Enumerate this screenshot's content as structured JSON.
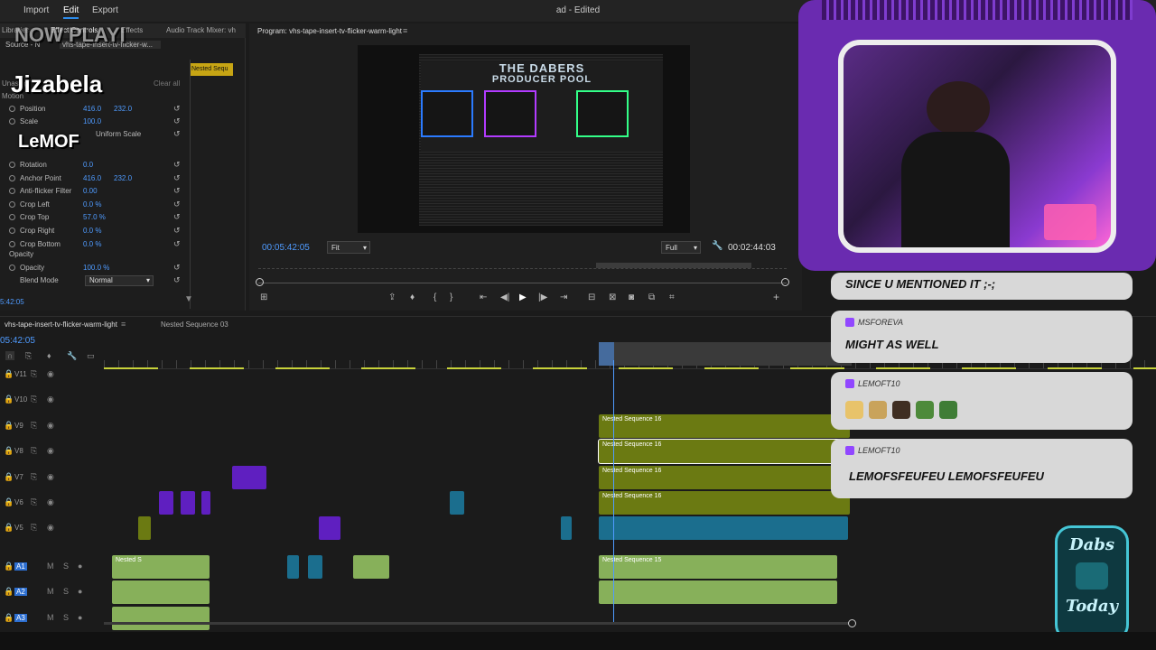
{
  "menu": {
    "items": [
      "Import",
      "Edit",
      "Export"
    ],
    "active": "Edit",
    "title": "ad - Edited"
  },
  "effects": {
    "tabs": [
      "Libraries",
      "Effect Controls",
      "Effects",
      "Audio Track Mixer: vh"
    ],
    "source_tab": "Source - N",
    "clip_tab": "vhs-tape-insert-tv-flicker-w...",
    "nested_label": "Nested Sequ",
    "clear_all": "Clear all",
    "section": "Unassig",
    "motion_label": "Motion",
    "rows": [
      {
        "label": "Position",
        "v1": "416.0",
        "v2": "232.0"
      },
      {
        "label": "Scale",
        "v1": "100.0",
        "v2": ""
      },
      {
        "label": "Uniform Scale",
        "v1": "",
        "v2": ""
      },
      {
        "label": "Rotation",
        "v1": "0.0",
        "v2": ""
      },
      {
        "label": "Anchor Point",
        "v1": "416.0",
        "v2": "232.0"
      },
      {
        "label": "Anti-flicker Filter",
        "v1": "0.00",
        "v2": ""
      },
      {
        "label": "Crop Left",
        "v1": "0.0 %",
        "v2": ""
      },
      {
        "label": "Crop Top",
        "v1": "57.0 %",
        "v2": ""
      },
      {
        "label": "Crop Right",
        "v1": "0.0 %",
        "v2": ""
      },
      {
        "label": "Crop Bottom",
        "v1": "0.0 %",
        "v2": ""
      }
    ],
    "opacity_section": "Opacity",
    "opacity_label": "Opacity",
    "opacity_value": "100.0 %",
    "blend_label": "Blend Mode",
    "blend_value": "Normal",
    "timecode": "5:42:05"
  },
  "overlays": {
    "now_playing": "NOW PLAYI",
    "name1": "Jizabela",
    "name2": "LeMOF"
  },
  "program": {
    "title": "Program: vhs-tape-insert-tv-flicker-warm-light",
    "screen_title": "THE DABERS",
    "screen_subtitle": "PRODUCER POOL",
    "timecode_left": "00:05:42:05",
    "fit": "Fit",
    "quality": "Full",
    "timecode_right": "00:02:44:03"
  },
  "timeline": {
    "tabs": [
      "vhs-tape-insert-tv-flicker-warm-light",
      "Nested Sequence 03"
    ],
    "timecode": "05:42:05",
    "tracks": [
      "V11",
      "V10",
      "V9",
      "V8",
      "V7",
      "V6",
      "V5",
      "A1",
      "A2",
      "A3"
    ],
    "clips": [
      "Nested Sequence 16",
      "Nested Sequence 16",
      "Nested Sequence 16",
      "Nested Sequence 16",
      "Nested Sequence 15",
      "Nested S"
    ]
  },
  "chat": [
    {
      "user": "",
      "message": "SINCE U MENTIONED IT ;-;"
    },
    {
      "user": "MSFOREVA",
      "message": "MIGHT AS WELL"
    },
    {
      "user": "LEMOFT10",
      "message": ""
    },
    {
      "user": "LEMOFT10",
      "message": "LEMOFSFEUFEU   LEMOFSFEUFEU"
    }
  ],
  "logo": {
    "top": "Dabs",
    "bottom": "Today"
  },
  "colors": {
    "accent": "#2d8ceb",
    "clip_olive": "#6b7a12",
    "clip_purple": "#5f1fc0",
    "clip_teal": "#1b6e8e",
    "audio": "#87b05a",
    "frame": "#6a2bb0"
  }
}
